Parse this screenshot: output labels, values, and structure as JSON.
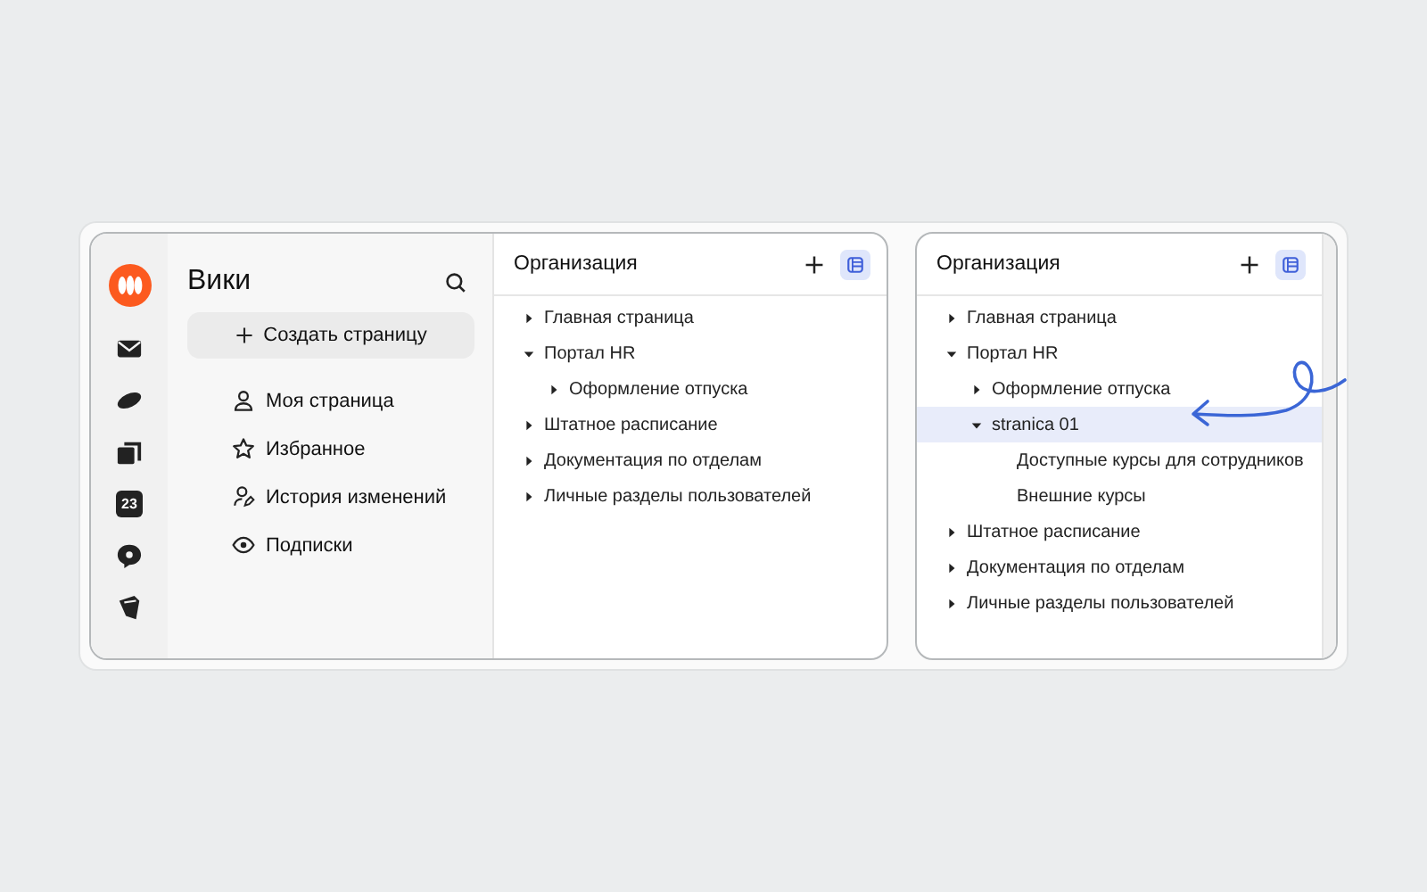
{
  "rail": {
    "icons": [
      {
        "kind": "logo"
      },
      {
        "kind": "mail"
      },
      {
        "kind": "disk"
      },
      {
        "kind": "squares"
      },
      {
        "kind": "calendar",
        "text": "23"
      },
      {
        "kind": "chat"
      },
      {
        "kind": "tracker"
      }
    ]
  },
  "sidebar": {
    "title": "Вики",
    "create_button": "Создать страницу",
    "items": [
      {
        "kind": "person",
        "label": "Моя страница"
      },
      {
        "kind": "star",
        "label": "Избранное"
      },
      {
        "kind": "history",
        "label": "История изменений"
      },
      {
        "kind": "eye",
        "label": "Подписки"
      }
    ]
  },
  "tree_panels": [
    {
      "title": "Организация",
      "items": [
        {
          "label": "Главная страница",
          "kind": "branch",
          "expanded": false,
          "selected": false
        },
        {
          "label": "Портал HR",
          "kind": "branch",
          "expanded": true,
          "selected": false,
          "children": [
            {
              "label": "Оформление отпуска",
              "kind": "branch",
              "expanded": false,
              "selected": false
            }
          ]
        },
        {
          "label": "Штатное расписание",
          "kind": "branch",
          "expanded": false,
          "selected": false
        },
        {
          "label": "Документация по отделам",
          "kind": "branch",
          "expanded": false,
          "selected": false
        },
        {
          "label": "Личные разделы пользователей",
          "kind": "branch",
          "expanded": false,
          "selected": false
        }
      ]
    },
    {
      "title": "Организация",
      "items": [
        {
          "label": "Главная страница",
          "kind": "branch",
          "expanded": false,
          "selected": false
        },
        {
          "label": "Портал HR",
          "kind": "branch",
          "expanded": true,
          "selected": false,
          "children": [
            {
              "label": "Оформление отпуска",
              "kind": "branch",
              "expanded": false,
              "selected": false
            },
            {
              "label": "stranica 01",
              "kind": "branch",
              "expanded": true,
              "selected": true,
              "children": [
                {
                  "label": "Доступные курсы для сотрудников",
                  "kind": "leaf",
                  "expanded": false,
                  "selected": false
                },
                {
                  "label": "Внешние курсы",
                  "kind": "leaf",
                  "expanded": false,
                  "selected": false
                }
              ]
            }
          ]
        },
        {
          "label": "Штатное расписание",
          "kind": "branch",
          "expanded": false,
          "selected": false
        },
        {
          "label": "Документация по отделам",
          "kind": "branch",
          "expanded": false,
          "selected": false
        },
        {
          "label": "Личные разделы пользователей",
          "kind": "branch",
          "expanded": false,
          "selected": false
        }
      ]
    }
  ]
}
